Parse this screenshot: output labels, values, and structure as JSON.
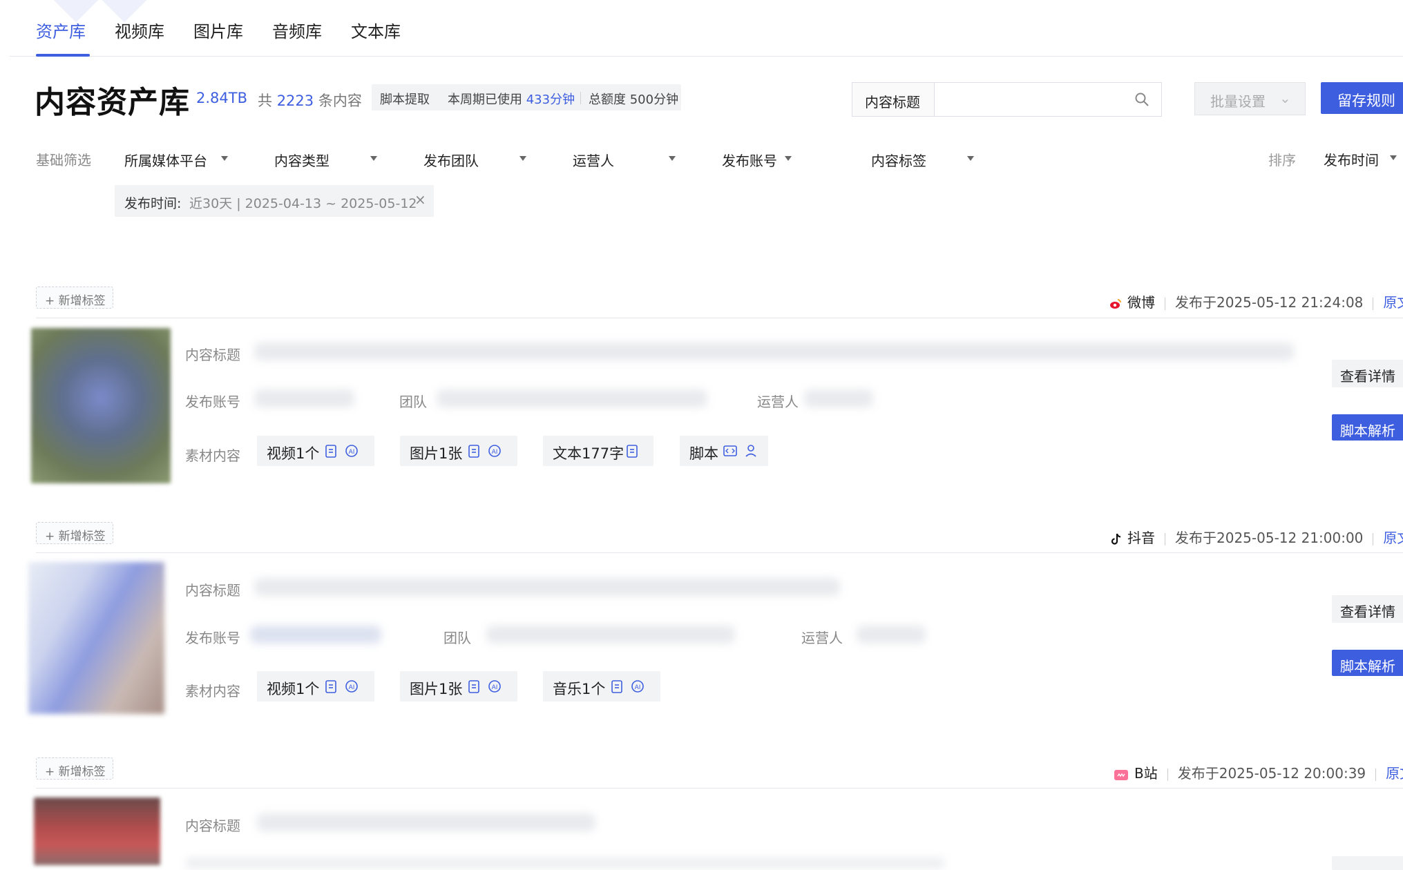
{
  "tabs": [
    {
      "label": "资产库",
      "active": true
    },
    {
      "label": "视频库"
    },
    {
      "label": "图片库"
    },
    {
      "label": "音频库"
    },
    {
      "label": "文本库"
    }
  ],
  "header": {
    "title": "内容资产库",
    "storage": "2.84TB",
    "count_prefix": "共",
    "count": "2223",
    "count_suffix": "条内容",
    "quota": {
      "label": "脚本提取",
      "used_label": "本周期已使用",
      "used_value": "433分钟",
      "total_label": "总额度",
      "total_value": "500分钟"
    },
    "search": {
      "field": "内容标题",
      "placeholder": ""
    },
    "batch_button": "批量设置",
    "save_button": "留存规则"
  },
  "filters": {
    "label": "基础筛选",
    "items": [
      "所属媒体平台",
      "内容类型",
      "发布团队",
      "运营人",
      "发布账号",
      "内容标签"
    ],
    "sort_label": "排序",
    "sort_value": "发布时间",
    "active_chip": {
      "key": "发布时间:",
      "value": "近30天 | 2025-04-13 ~ 2025-05-12"
    }
  },
  "cards": [
    {
      "tag_button": "+ 新增标签",
      "platform": "微博",
      "published": "发布于2025-05-12 21:24:08",
      "link": "原文",
      "labels": {
        "title": "内容标题",
        "account": "发布账号",
        "team": "团队",
        "operator": "运营人",
        "materials": "素材内容"
      },
      "materials": [
        "视频1个",
        "图片1张",
        "文本177字",
        "脚本"
      ],
      "detail_button": "查看详情",
      "script_button": "脚本解析"
    },
    {
      "tag_button": "+ 新增标签",
      "platform": "抖音",
      "published": "发布于2025-05-12 21:00:00",
      "link": "原文",
      "labels": {
        "title": "内容标题",
        "account": "发布账号",
        "team": "团队",
        "operator": "运营人",
        "materials": "素材内容"
      },
      "materials": [
        "视频1个",
        "图片1张",
        "音乐1个"
      ],
      "detail_button": "查看详情",
      "script_button": "脚本解析"
    },
    {
      "tag_button": "+ 新增标签",
      "platform": "B站",
      "published": "发布于2025-05-12 20:00:39",
      "link": "原文",
      "labels": {
        "title": "内容标题"
      }
    }
  ],
  "colors": {
    "accent": "#3e5ee0",
    "weibo": "#e6162d",
    "bilibili": "#fb7299"
  }
}
